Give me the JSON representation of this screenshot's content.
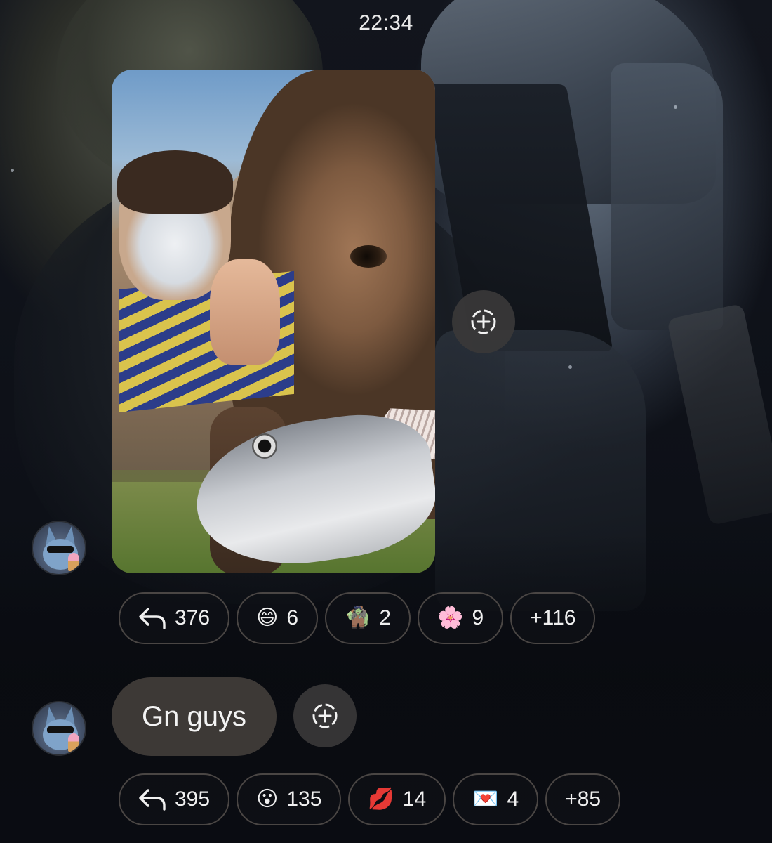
{
  "status": {
    "time": "22:34"
  },
  "messages": [
    {
      "type": "photo",
      "reactions": [
        {
          "icon": "reply-arrow-icon",
          "count": "376"
        },
        {
          "icon": "grinning-face-emoji",
          "emoji": "😄",
          "count": "6"
        },
        {
          "icon": "ogre-sticker-emoji",
          "emoji": "🧌",
          "count": "2"
        },
        {
          "icon": "cherry-blossom-emoji",
          "emoji": "🌸",
          "count": "9"
        },
        {
          "icon": "more-reactions",
          "count": "+116"
        }
      ]
    },
    {
      "type": "text",
      "text": "Gn guys",
      "reactions": [
        {
          "icon": "reply-arrow-icon",
          "count": "395"
        },
        {
          "icon": "surprised-face-emoji",
          "emoji": "😮",
          "count": "135"
        },
        {
          "icon": "kiss-mark-emoji",
          "emoji": "💋",
          "count": "14"
        },
        {
          "icon": "love-letter-emoji",
          "emoji": "💌",
          "count": "4"
        },
        {
          "icon": "more-reactions",
          "count": "+85"
        }
      ]
    }
  ]
}
